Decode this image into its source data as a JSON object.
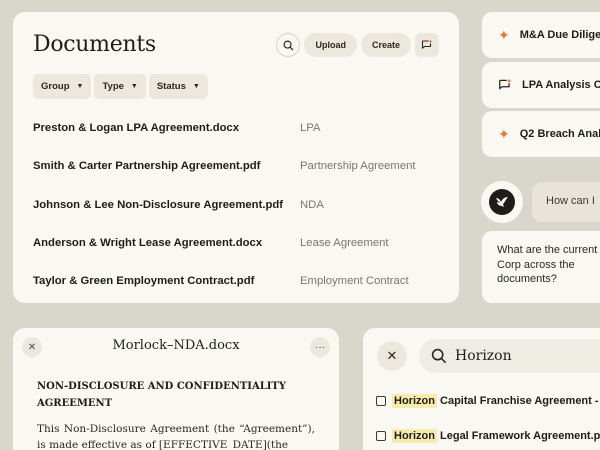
{
  "documents": {
    "title": "Documents",
    "upload_label": "Upload",
    "create_label": "Create",
    "filters": [
      "Group",
      "Type",
      "Status"
    ],
    "rows": [
      {
        "name": "Preston & Logan LPA Agreement.docx",
        "type": "LPA"
      },
      {
        "name": "Smith & Carter Partnership Agreement.pdf",
        "type": "Partnership Agreement"
      },
      {
        "name": "Johnson & Lee Non-Disclosure Agreement.pdf",
        "type": "NDA"
      },
      {
        "name": "Anderson & Wright Lease Agreement.docx",
        "type": "Lease Agreement"
      },
      {
        "name": "Taylor & Green Employment Contract.pdf",
        "type": "Employment Contract"
      }
    ]
  },
  "side": {
    "items": [
      {
        "label": "M&A Due Dilige",
        "icon": "sparkle-icon"
      },
      {
        "label": "LPA Analysis Cl",
        "icon": "chat-sparkle-icon"
      },
      {
        "label": "Q2 Breach Anal",
        "icon": "sparkle-icon"
      }
    ]
  },
  "chat": {
    "question": "How can I",
    "answer": "What are the current City Corp across the documents?"
  },
  "nda": {
    "title": "Morlock–NDA.docx",
    "heading": "NON-DISCLOSURE AND CONFIDENTIALITY AGREEMENT",
    "body": "This Non-Disclosure Agreement (the “Agreement”), is made effective as of [EFFECTIVE_DATE](the"
  },
  "search": {
    "query": "Horizon",
    "results": [
      {
        "highlight": "Horizon",
        "rest": " Capital Franchise Agreement - S"
      },
      {
        "highlight": "Horizon",
        "rest": " Legal Framework Agreement.pd"
      }
    ]
  },
  "colors": {
    "accent": "#e8763a",
    "highlight": "#f7ecae",
    "card": "#faf8f3",
    "background": "#d9d6cc"
  }
}
